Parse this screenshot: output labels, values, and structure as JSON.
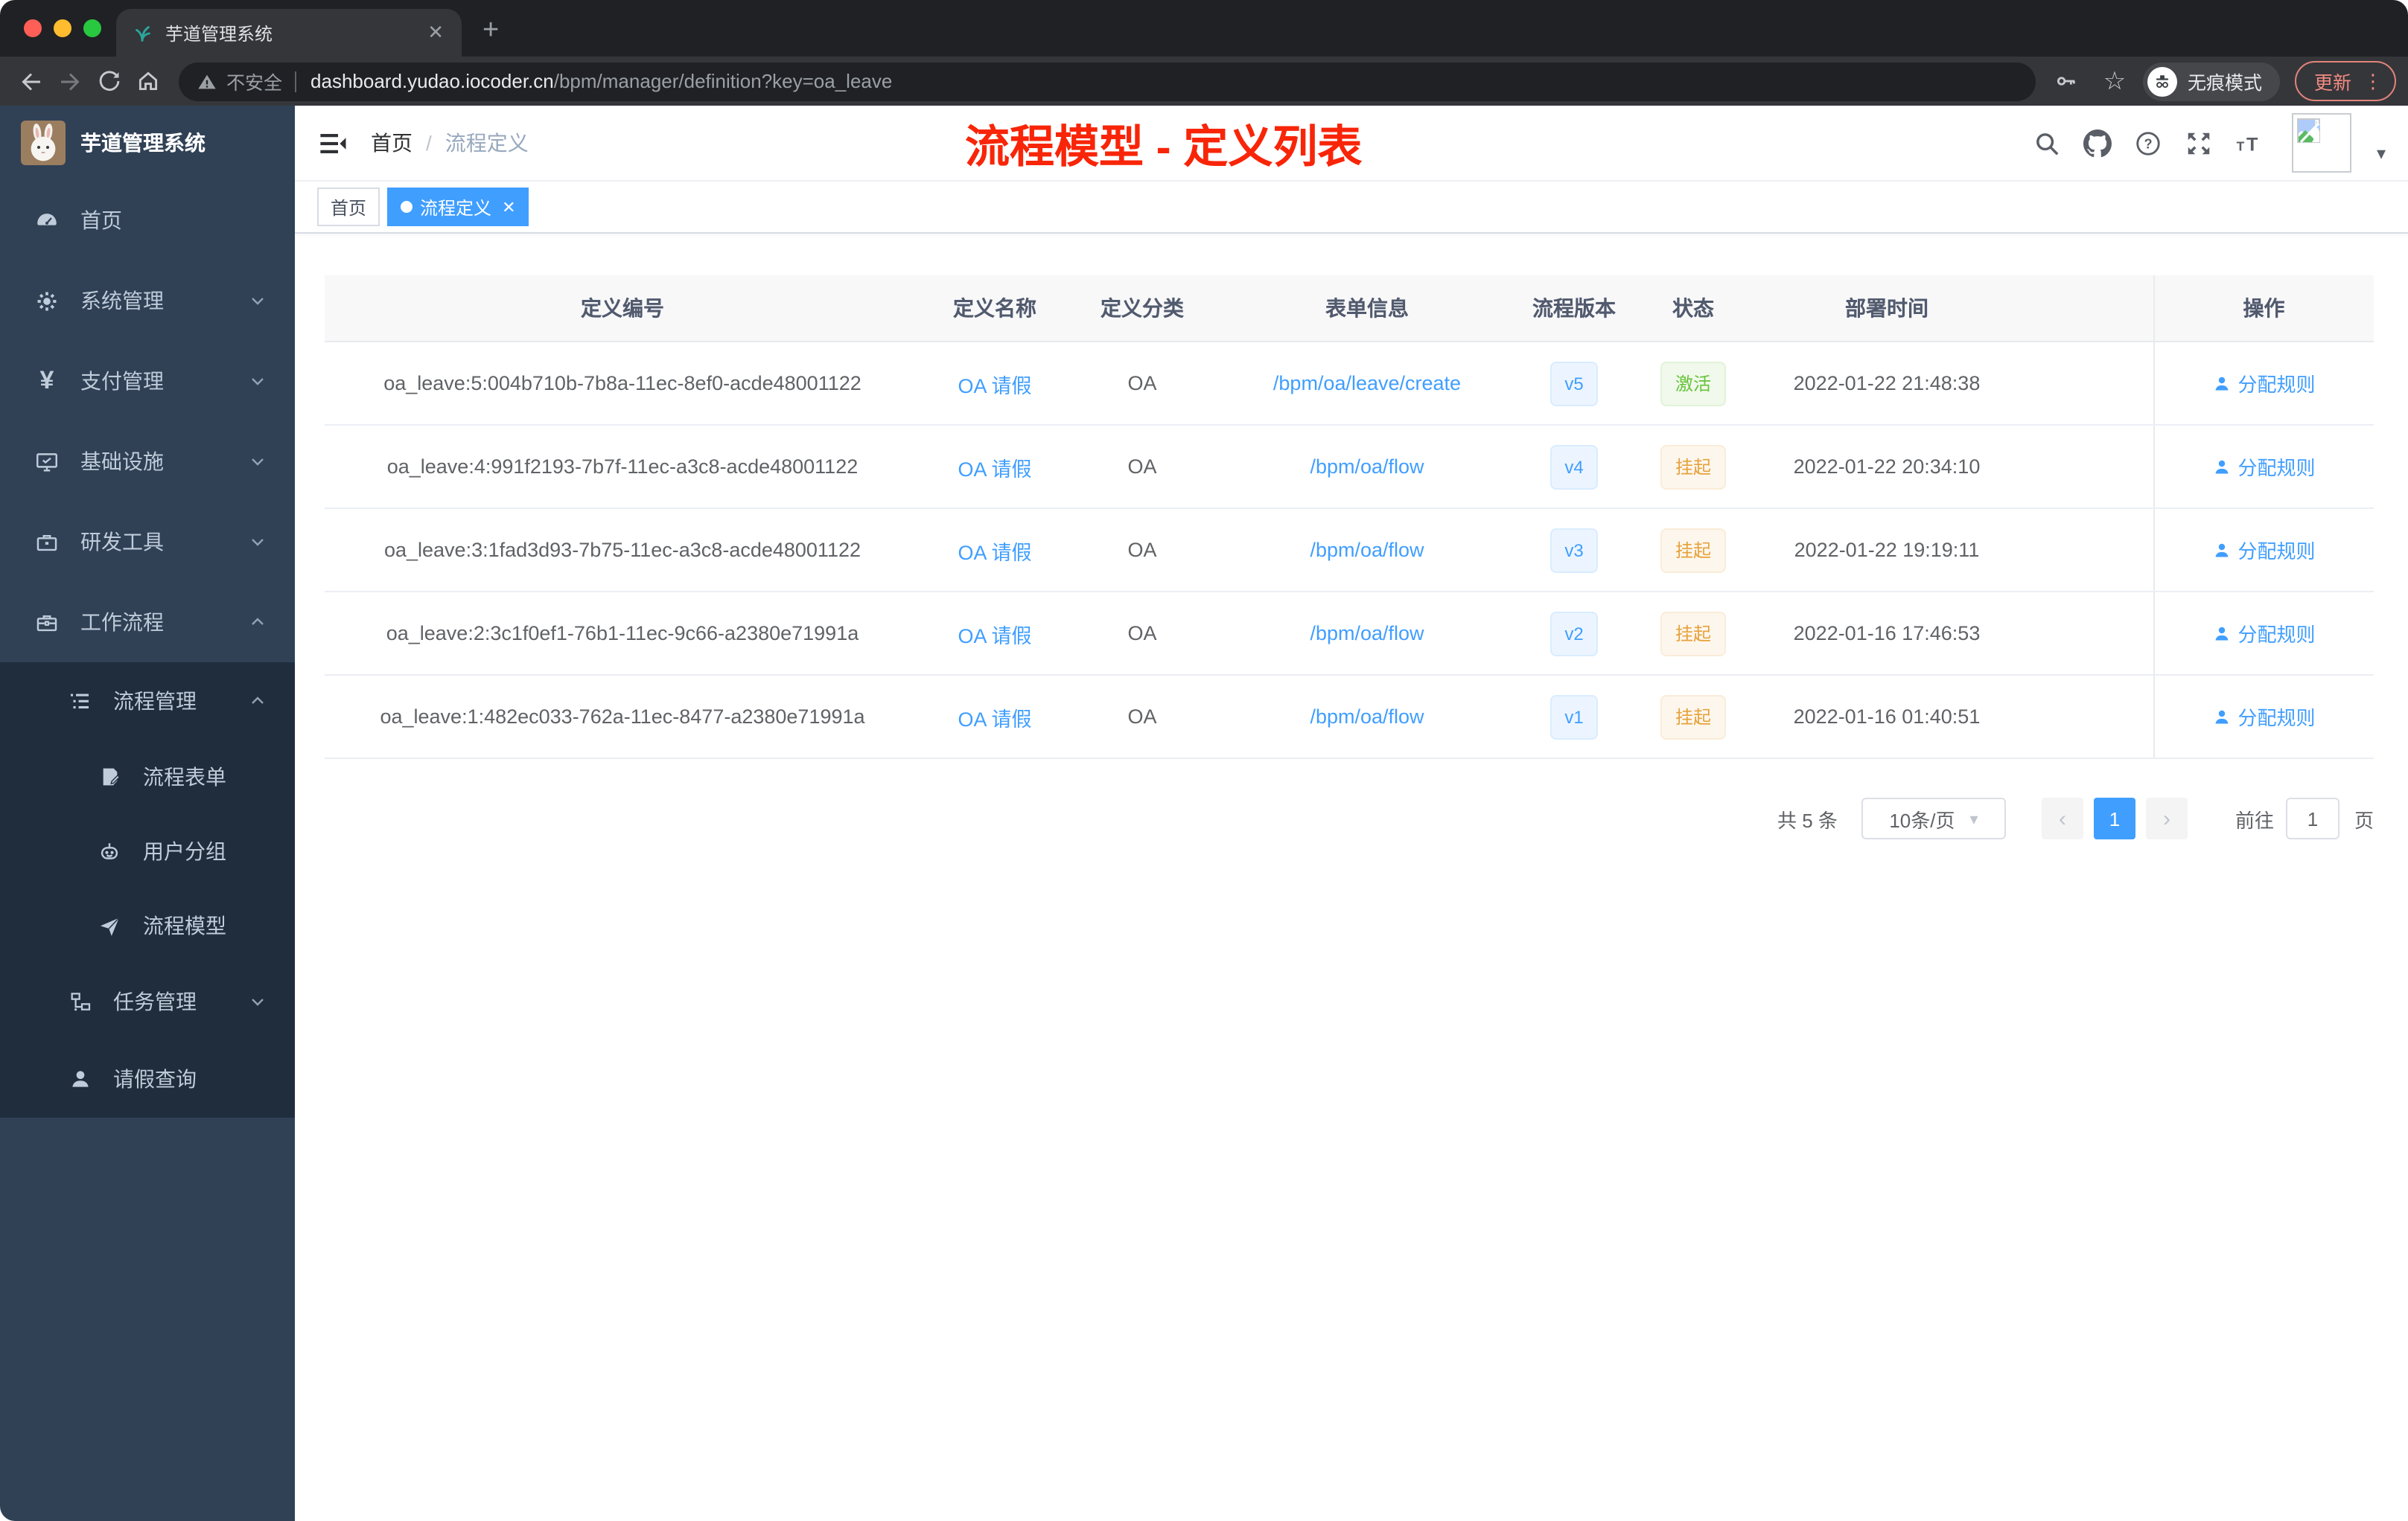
{
  "browser": {
    "tab_title": "芋道管理系统",
    "security_label": "不安全",
    "url_host": "dashboard.yudao.iocoder.cn",
    "url_path": "/bpm/manager/definition?key=oa_leave",
    "incognito_label": "无痕模式",
    "update_label": "更新"
  },
  "icons": {
    "close": "✕",
    "plus": "+",
    "dots_vertical": "⋮",
    "star": "☆",
    "caret_down": "▾",
    "chevron_left": "‹",
    "chevron_right": "›"
  },
  "sidebar": {
    "logo_title": "芋道管理系统",
    "items": [
      {
        "label": "首页",
        "icon": "dashboard-icon"
      },
      {
        "label": "系统管理",
        "icon": "gear-icon"
      },
      {
        "label": "支付管理",
        "icon": "yen-icon"
      },
      {
        "label": "基础设施",
        "icon": "monitor-icon"
      },
      {
        "label": "研发工具",
        "icon": "toolbox-icon"
      },
      {
        "label": "工作流程",
        "icon": "briefcase-icon"
      },
      {
        "label": "流程管理",
        "icon": "list-tree-icon"
      },
      {
        "label": "流程表单",
        "icon": "form-icon"
      },
      {
        "label": "用户分组",
        "icon": "robot-icon"
      },
      {
        "label": "流程模型",
        "icon": "paper-plane-icon"
      },
      {
        "label": "任务管理",
        "icon": "org-tree-icon"
      },
      {
        "label": "请假查询",
        "icon": "user-icon"
      }
    ]
  },
  "header": {
    "breadcrumb_home": "首页",
    "breadcrumb_separator": "/",
    "breadcrumb_current": "流程定义"
  },
  "annotation": {
    "title": "流程模型 - 定义列表"
  },
  "tags": {
    "home": "首页",
    "active": "流程定义"
  },
  "table": {
    "columns": [
      "定义编号",
      "定义名称",
      "定义分类",
      "表单信息",
      "流程版本",
      "状态",
      "部署时间",
      "操作"
    ],
    "rows": [
      {
        "id": "oa_leave:5:004b710b-7b8a-11ec-8ef0-acde48001122",
        "name": "OA 请假",
        "category": "OA",
        "form": "/bpm/oa/leave/create",
        "version": "v5",
        "status": "激活",
        "deploy_time": "2022-01-22 21:48:38",
        "action": "分配规则"
      },
      {
        "id": "oa_leave:4:991f2193-7b7f-11ec-a3c8-acde48001122",
        "name": "OA 请假",
        "category": "OA",
        "form": "/bpm/oa/flow",
        "version": "v4",
        "status": "挂起",
        "deploy_time": "2022-01-22 20:34:10",
        "action": "分配规则"
      },
      {
        "id": "oa_leave:3:1fad3d93-7b75-11ec-a3c8-acde48001122",
        "name": "OA 请假",
        "category": "OA",
        "form": "/bpm/oa/flow",
        "version": "v3",
        "status": "挂起",
        "deploy_time": "2022-01-22 19:19:11",
        "action": "分配规则"
      },
      {
        "id": "oa_leave:2:3c1f0ef1-76b1-11ec-9c66-a2380e71991a",
        "name": "OA 请假",
        "category": "OA",
        "form": "/bpm/oa/flow",
        "version": "v2",
        "status": "挂起",
        "deploy_time": "2022-01-16 17:46:53",
        "action": "分配规则"
      },
      {
        "id": "oa_leave:1:482ec033-762a-11ec-8477-a2380e71991a",
        "name": "OA 请假",
        "category": "OA",
        "form": "/bpm/oa/flow",
        "version": "v1",
        "status": "挂起",
        "deploy_time": "2022-01-16 01:40:51",
        "action": "分配规则"
      }
    ]
  },
  "pagination": {
    "total_label": "共 5 条",
    "page_size_label": "10条/页",
    "current_page": "1",
    "goto_label": "前往",
    "goto_value": "1",
    "page_unit_label": "页"
  },
  "colors": {
    "accent": "#409eff",
    "link": "#409eff",
    "success": "#67c23a",
    "warning": "#e6a23c",
    "annotation_red": "#f82508",
    "sidebar_bg": "#304156",
    "submenu_bg": "#1f2d3d",
    "update_chip": "#f28b82"
  }
}
